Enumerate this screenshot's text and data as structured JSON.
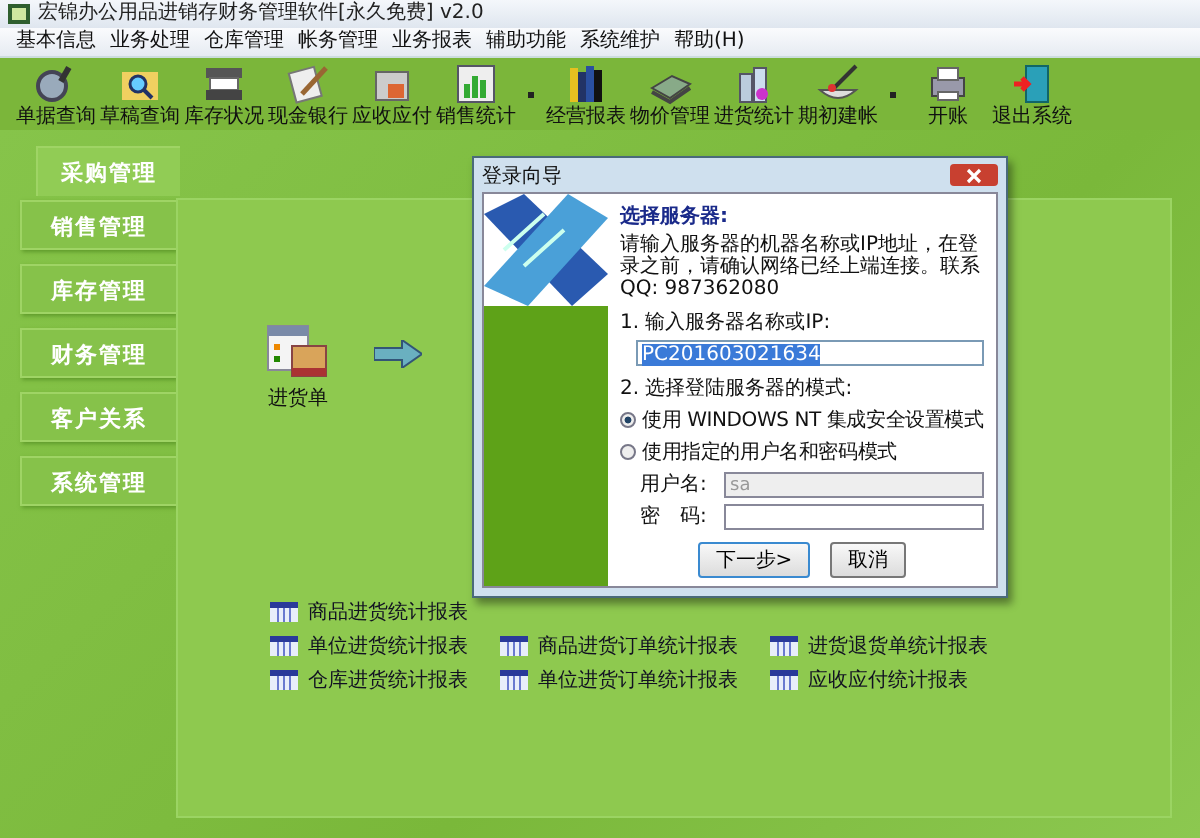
{
  "window": {
    "title": "宏锦办公用品进销存财务管理软件[永久免费] v2.0"
  },
  "menu": [
    "基本信息",
    "业务处理",
    "仓库管理",
    "帐务管理",
    "业务报表",
    "辅助功能",
    "系统维护",
    "帮助(H)"
  ],
  "toolbar": [
    {
      "kind": "button",
      "label": "单据查询"
    },
    {
      "kind": "button",
      "label": "草稿查询"
    },
    {
      "kind": "button",
      "label": "库存状况"
    },
    {
      "kind": "button",
      "label": "现金银行"
    },
    {
      "kind": "button",
      "label": "应收应付"
    },
    {
      "kind": "button",
      "label": "销售统计"
    },
    {
      "kind": "separator"
    },
    {
      "kind": "button",
      "label": "经营报表"
    },
    {
      "kind": "button",
      "label": "物价管理"
    },
    {
      "kind": "button",
      "label": "进货统计"
    },
    {
      "kind": "button",
      "label": "期初建帐"
    },
    {
      "kind": "separator"
    },
    {
      "kind": "button",
      "label": "开账"
    },
    {
      "kind": "button",
      "label": "退出系统"
    }
  ],
  "modules": [
    {
      "label": "采购管理",
      "selected": true
    },
    {
      "label": "销售管理",
      "selected": false
    },
    {
      "label": "库存管理",
      "selected": false
    },
    {
      "label": "财务管理",
      "selected": false
    },
    {
      "label": "客户关系",
      "selected": false
    },
    {
      "label": "系统管理",
      "selected": false
    }
  ],
  "workflow": [
    {
      "label": "进货单"
    }
  ],
  "reports": [
    [
      "商品进货统计报表",
      "单位进货统计报表",
      "仓库进货统计报表"
    ],
    [
      "商品进货订单统计报表",
      "单位进货订单统计报表"
    ],
    [
      "进货退货单统计报表",
      "应收应付统计报表"
    ]
  ],
  "dialog": {
    "title": "登录向导",
    "heading": "选择服务器:",
    "message": "请输入服务器的机器名称或IP地址，在登录之前，请确认网络已经上端连接。联系QQ: 987362080",
    "server_label": "1. 输入服务器名称或IP:",
    "server_value": "PC201603021634",
    "mode_label": "2. 选择登陆服务器的模式:",
    "modes": [
      {
        "label": "使用 WINDOWS NT 集成安全设置模式",
        "selected": true
      },
      {
        "label": "使用指定的用户名和密码模式",
        "selected": false
      }
    ],
    "username": {
      "label": "用户名:",
      "value": "sa",
      "disabled": true
    },
    "password": {
      "label": "密　码:"
    },
    "buttons": [
      {
        "label": "下一步>",
        "default": true
      },
      {
        "label": "取消",
        "default": false
      }
    ]
  }
}
